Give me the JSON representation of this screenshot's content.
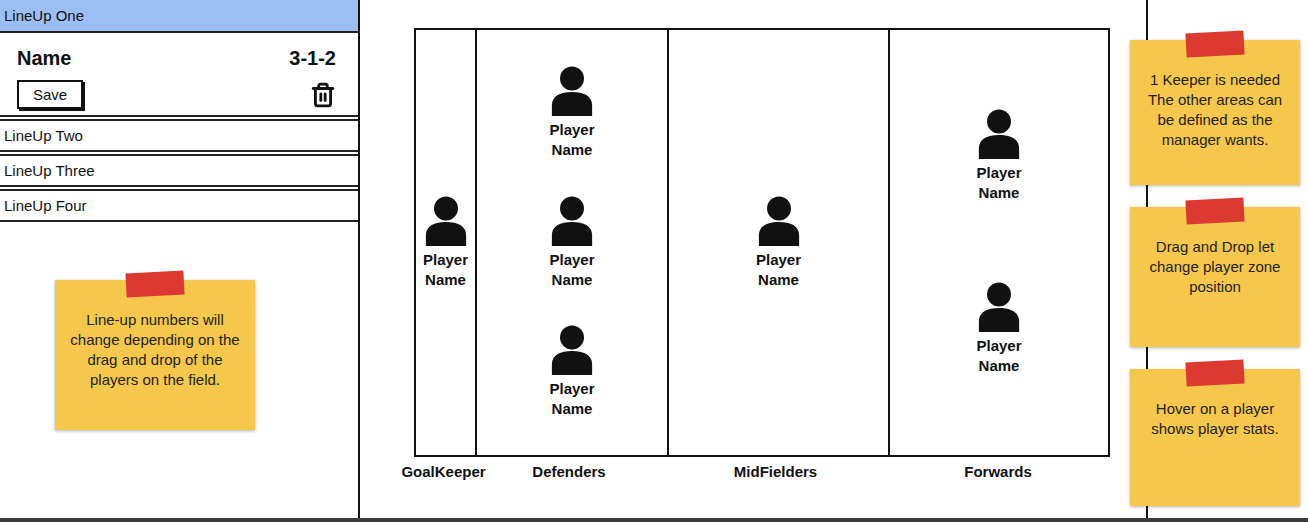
{
  "sidebar": {
    "lineups": [
      {
        "name": "LineUp One",
        "selected": true,
        "expanded": true
      },
      {
        "name": "LineUp Two",
        "selected": false,
        "expanded": false
      },
      {
        "name": "LineUp Three",
        "selected": false,
        "expanded": false
      },
      {
        "name": "LineUp Four",
        "selected": false,
        "expanded": false
      }
    ],
    "detail": {
      "name": "Name",
      "formation": "3-1-2",
      "save": "Save"
    },
    "note": "Line-up numbers will change depending on the drag and drop of the players on the field."
  },
  "field": {
    "zones": [
      {
        "label": "GoalKeeper",
        "players": [
          {
            "name": "Player Name"
          }
        ]
      },
      {
        "label": "Defenders",
        "players": [
          {
            "name": "Player Name"
          },
          {
            "name": "Player Name"
          },
          {
            "name": "Player Name"
          }
        ]
      },
      {
        "label": "MidFielders",
        "players": [
          {
            "name": "Player Name"
          }
        ]
      },
      {
        "label": "Forwards",
        "players": [
          {
            "name": "Player Name"
          },
          {
            "name": "Player Name"
          }
        ]
      }
    ]
  },
  "notes": [
    {
      "text": "1 Keeper is needed The other areas can be defined as the manager wants."
    },
    {
      "text": "Drag and Drop let change player zone position"
    },
    {
      "text": "Hover on a player shows player stats."
    }
  ]
}
